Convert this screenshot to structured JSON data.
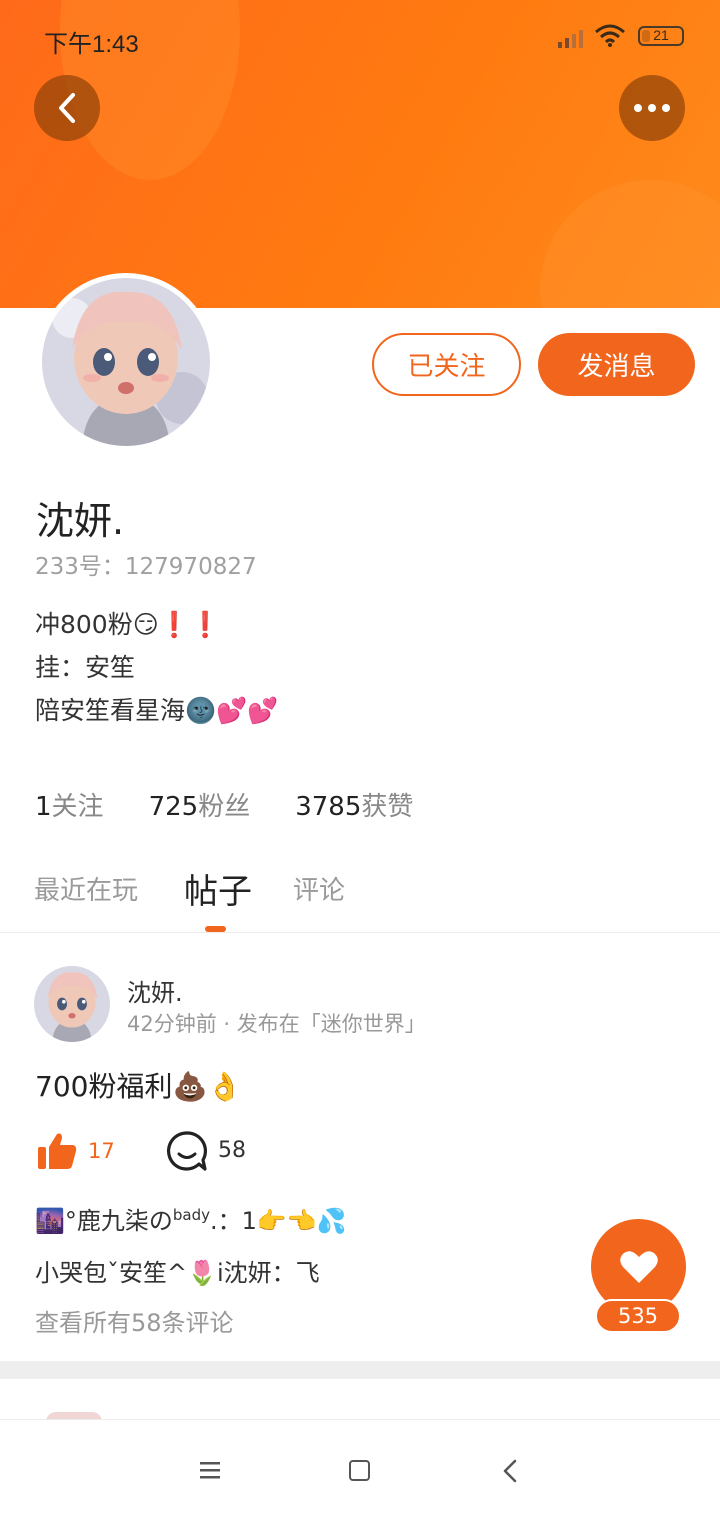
{
  "status_bar": {
    "time": "下午1:43",
    "battery": "21"
  },
  "profile": {
    "username": "沈妍.",
    "user_id": "233号：127970827",
    "bio": [
      "冲800粉😏❗❗",
      "挂：安笙",
      "陪安笙看星海🌚💕💕"
    ],
    "followed_label": "已关注",
    "message_label": "发消息",
    "stats": [
      {
        "num": "1",
        "label": "关注"
      },
      {
        "num": "725",
        "label": "粉丝"
      },
      {
        "num": "3785",
        "label": "获赞"
      }
    ]
  },
  "tabs": [
    "最近在玩",
    "帖子",
    "评论"
  ],
  "active_tab": "帖子",
  "post": {
    "author": "沈妍.",
    "meta": "42分钟前 · 发布在「迷你世界」",
    "text": "700粉福利💩👌",
    "likes": "17",
    "comments": "58",
    "comment_1_name": "🌆°鹿九柒の",
    "comment_1_sup": "bady",
    "comment_1_body": ".：1👉👈💦",
    "comment_2": "小哭包ˇ安笙^🌷i沈妍：飞",
    "view_all": "查看所有58条评论"
  },
  "fab": {
    "count": "535"
  },
  "colors": {
    "accent": "#f2651c",
    "banner": "#ff7a10"
  }
}
